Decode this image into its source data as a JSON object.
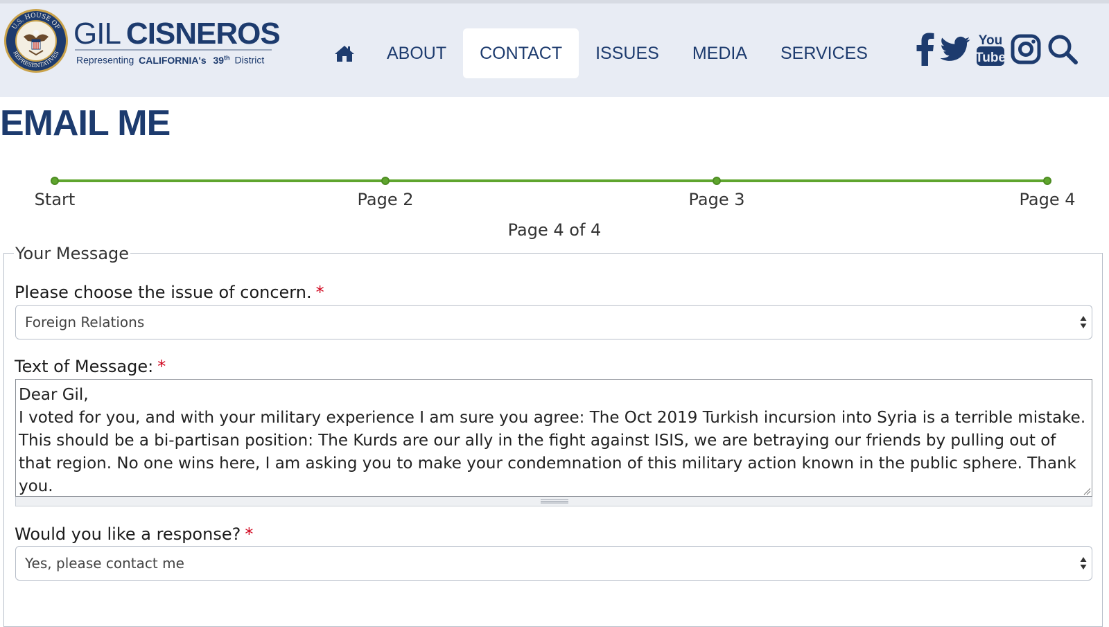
{
  "header": {
    "brand": {
      "name_light": "GIL",
      "name_bold": "CISNEROS",
      "tagline_prefix": "Representing",
      "tagline_state": "CALIFORNIA's",
      "tagline_district_num": "39",
      "tagline_district_sup": "th",
      "tagline_suffix": "District"
    },
    "seal": {
      "icon": "us-house-seal-icon",
      "text_top": "U.S. HOUSE OF",
      "text_bottom": "REPRESENTATIVES"
    },
    "nav": {
      "items": [
        {
          "label": "ABOUT"
        },
        {
          "label": "CONTACT"
        },
        {
          "label": "ISSUES"
        },
        {
          "label": "MEDIA"
        },
        {
          "label": "SERVICES"
        }
      ],
      "active": "CONTACT",
      "home_icon": "home-icon"
    },
    "social": [
      "facebook-icon",
      "twitter-icon",
      "youtube-icon",
      "instagram-icon",
      "search-icon"
    ],
    "youtube_text_top": "You",
    "youtube_text_bottom": "Tube"
  },
  "page": {
    "title": "EMAIL ME"
  },
  "progress": {
    "steps": [
      {
        "label": "Start"
      },
      {
        "label": "Page 2"
      },
      {
        "label": "Page 3"
      },
      {
        "label": "Page 4"
      }
    ],
    "counter": "Page 4 of 4",
    "color": "#5fa52e"
  },
  "form": {
    "legend": "Your Message",
    "issue": {
      "label": "Please choose the issue of concern.",
      "required": "*",
      "value": "Foreign Relations"
    },
    "message": {
      "label": "Text of Message:",
      "required": "*",
      "line1": "Dear Gil,",
      "line2": "I voted for you, and with your military experience I am sure you agree: The Oct 2019 Turkish incursion into Syria is a terrible mistake. This should be a bi-partisan position: The Kurds are our ally in the fight against ISIS, we are betraying our friends by pulling out of that region. No one wins here, I am asking you to make your condemnation of this military action known in the public sphere. Thank you."
    },
    "response": {
      "label": "Would you like a response?",
      "required": "*",
      "value": "Yes, please contact me"
    }
  },
  "colors": {
    "navy": "#1d3b6e",
    "required": "#d0021b",
    "header_bg": "#e8ecf4"
  }
}
